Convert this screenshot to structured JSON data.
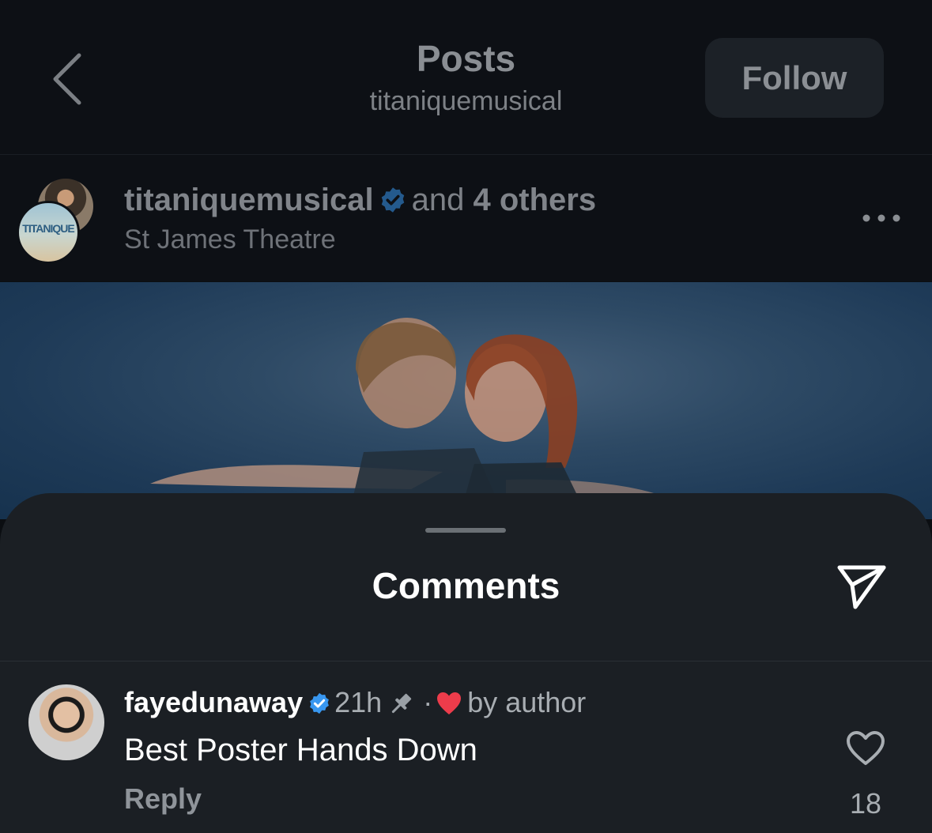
{
  "header": {
    "title": "Posts",
    "subtitle": "titaniquemusical",
    "follow_label": "Follow"
  },
  "post": {
    "username": "titaniquemusical",
    "and_label": "and",
    "others_label": "4 others",
    "location": "St James Theatre",
    "avatar_text": "TITANIQUE"
  },
  "comments_sheet": {
    "title": "Comments",
    "comments": [
      {
        "username": "fayedunaway",
        "time": "21h",
        "separator": "·",
        "liked_by": "by author",
        "text": "Best Poster Hands Down",
        "reply_label": "Reply",
        "like_count": "18"
      }
    ]
  },
  "colors": {
    "background": "#0b0e12",
    "sheet": "#1b1f24",
    "verified": "#3897f0",
    "heart": "#ed3c4b"
  }
}
